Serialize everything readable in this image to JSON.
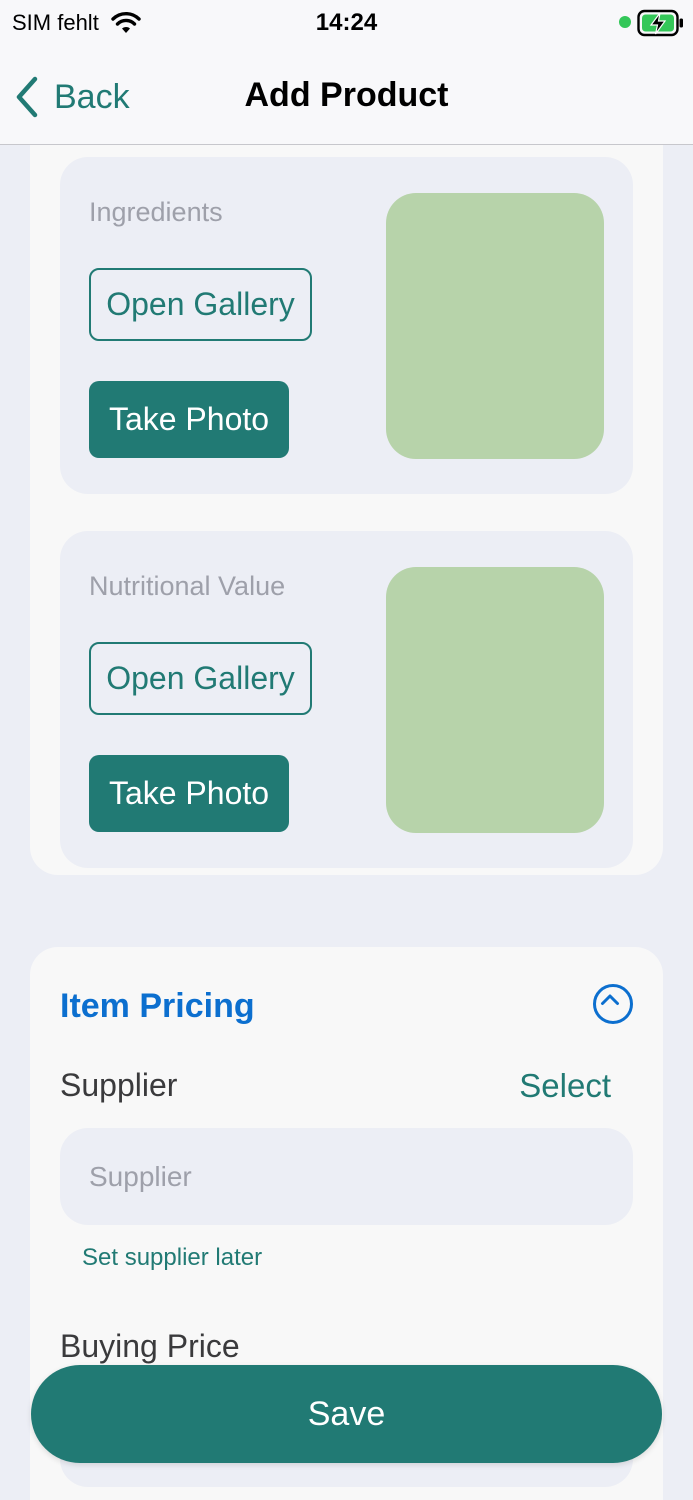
{
  "status_bar": {
    "carrier": "SIM fehlt",
    "time": "14:24",
    "wifi_icon": "wifi-icon",
    "battery_icon": "battery-charging-icon",
    "indicator_color": "#34c759"
  },
  "nav": {
    "back_label": "Back",
    "title": "Add Product",
    "back_icon": "chevron-left-icon"
  },
  "photo_sections": [
    {
      "label": "Ingredients",
      "gallery_button": "Open Gallery",
      "photo_button": "Take Photo"
    },
    {
      "label": "Nutritional Value",
      "gallery_button": "Open Gallery",
      "photo_button": "Take Photo"
    }
  ],
  "pricing": {
    "title": "Item Pricing",
    "collapse_icon": "chevron-up-circle-icon",
    "supplier_label": "Supplier",
    "select_label": "Select",
    "supplier_placeholder": "Supplier",
    "supplier_value": "",
    "supplier_later_label": "Set supplier later",
    "buying_price_label": "Buying Price"
  },
  "footer": {
    "save_label": "Save"
  },
  "colors": {
    "accent": "#217a74",
    "link_blue": "#0c6fcf",
    "placeholder_green": "#b7d3aa",
    "background": "#eceef5"
  }
}
